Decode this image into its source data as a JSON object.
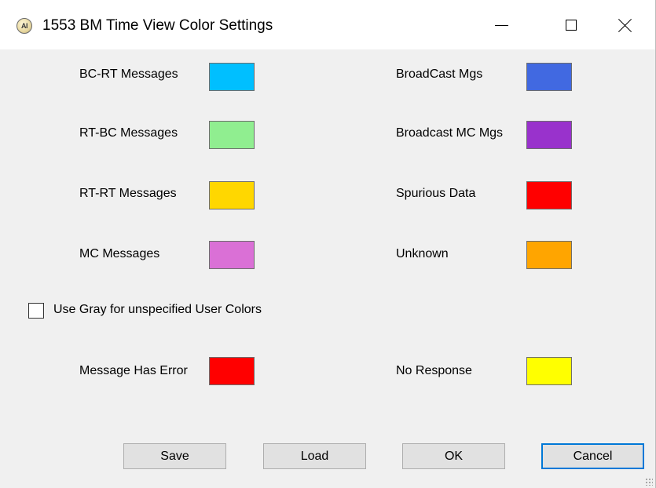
{
  "window": {
    "title": "1553 BM Time View Color Settings",
    "icon": "app-logo-icon",
    "icon_text": "AI",
    "controls": {
      "minimize": "minimize-icon",
      "maximize": "maximize-icon",
      "close": "close-icon"
    }
  },
  "colors": {
    "left": [
      {
        "label": "BC-RT Messages",
        "color": "#00bfff"
      },
      {
        "label": "RT-BC Messages",
        "color": "#90ee90"
      },
      {
        "label": "RT-RT Messages",
        "color": "#ffd700"
      },
      {
        "label": "MC Messages",
        "color": "#da70d6"
      }
    ],
    "right": [
      {
        "label": "BroadCast Mgs",
        "color": "#4169e1"
      },
      {
        "label": "Broadcast MC Mgs",
        "color": "#9932cc"
      },
      {
        "label": "Spurious Data",
        "color": "#ff0000"
      },
      {
        "label": "Unknown",
        "color": "#ffa500"
      }
    ],
    "error": {
      "label": "Message Has Error",
      "color": "#ff0000"
    },
    "no_response": {
      "label": "No Response",
      "color": "#ffff00"
    }
  },
  "options": {
    "use_gray_label": "Use Gray for unspecified User Colors",
    "use_gray_checked": false
  },
  "buttons": {
    "save": "Save",
    "load": "Load",
    "ok": "OK",
    "cancel": "Cancel"
  }
}
